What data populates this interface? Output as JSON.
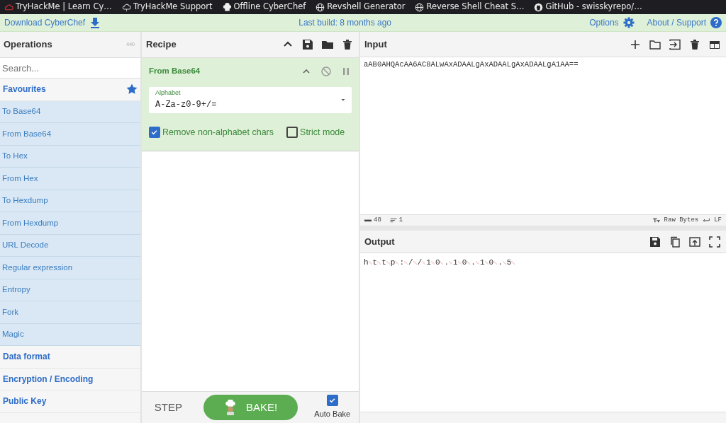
{
  "bookmarks": [
    {
      "label": "TryHackMe | Learn Cy…",
      "kind": "cloud"
    },
    {
      "label": "TryHackMe Support",
      "kind": "cloud-outline"
    },
    {
      "label": "Offline CyberChef",
      "kind": "chef"
    },
    {
      "label": "Revshell Generator",
      "kind": "globe"
    },
    {
      "label": "Reverse Shell Cheat S…",
      "kind": "globe"
    },
    {
      "label": "GitHub - swisskyrepo/…",
      "kind": "github"
    }
  ],
  "banner": {
    "download": "Download CyberChef",
    "last_build": "Last build: 8 months ago",
    "options": "Options",
    "about": "About / Support"
  },
  "operations": {
    "title": "Operations",
    "count": "440",
    "search_placeholder": "Search...",
    "categories": [
      {
        "label": "Favourites",
        "expanded": true,
        "items": [
          "To Base64",
          "From Base64",
          "To Hex",
          "From Hex",
          "To Hexdump",
          "From Hexdump",
          "URL Decode",
          "Regular expression",
          "Entropy",
          "Fork",
          "Magic"
        ]
      },
      {
        "label": "Data format",
        "expanded": false
      },
      {
        "label": "Encryption / Encoding",
        "expanded": false
      },
      {
        "label": "Public Key",
        "expanded": false
      }
    ]
  },
  "recipe": {
    "title": "Recipe",
    "steps": [
      {
        "name": "From Base64",
        "disabled": false,
        "alphabet_label": "Alphabet",
        "alphabet": "A-Za-z0-9+/=",
        "options": [
          {
            "label": "Remove non-alphabet chars",
            "checked": true
          },
          {
            "label": "Strict mode",
            "checked": false
          }
        ]
      }
    ],
    "step": "STEP",
    "bake": "BAKE!",
    "auto_bake": {
      "label": "Auto Bake",
      "checked": true
    }
  },
  "input": {
    "title": "Input",
    "value": "aAB0AHQAcAA6AC8ALwAxADAALgAxADAALgAxADAALgA1AA==",
    "status": {
      "length": "48",
      "lines": "1",
      "encoding": "Raw Bytes",
      "eol": "LF"
    }
  },
  "output": {
    "title": "Output",
    "value": "h␀t␀t␀p␀:␀/␀/␀1␀0␀.␀1␀0␀.␀1␀0␀.␀5␀"
  }
}
